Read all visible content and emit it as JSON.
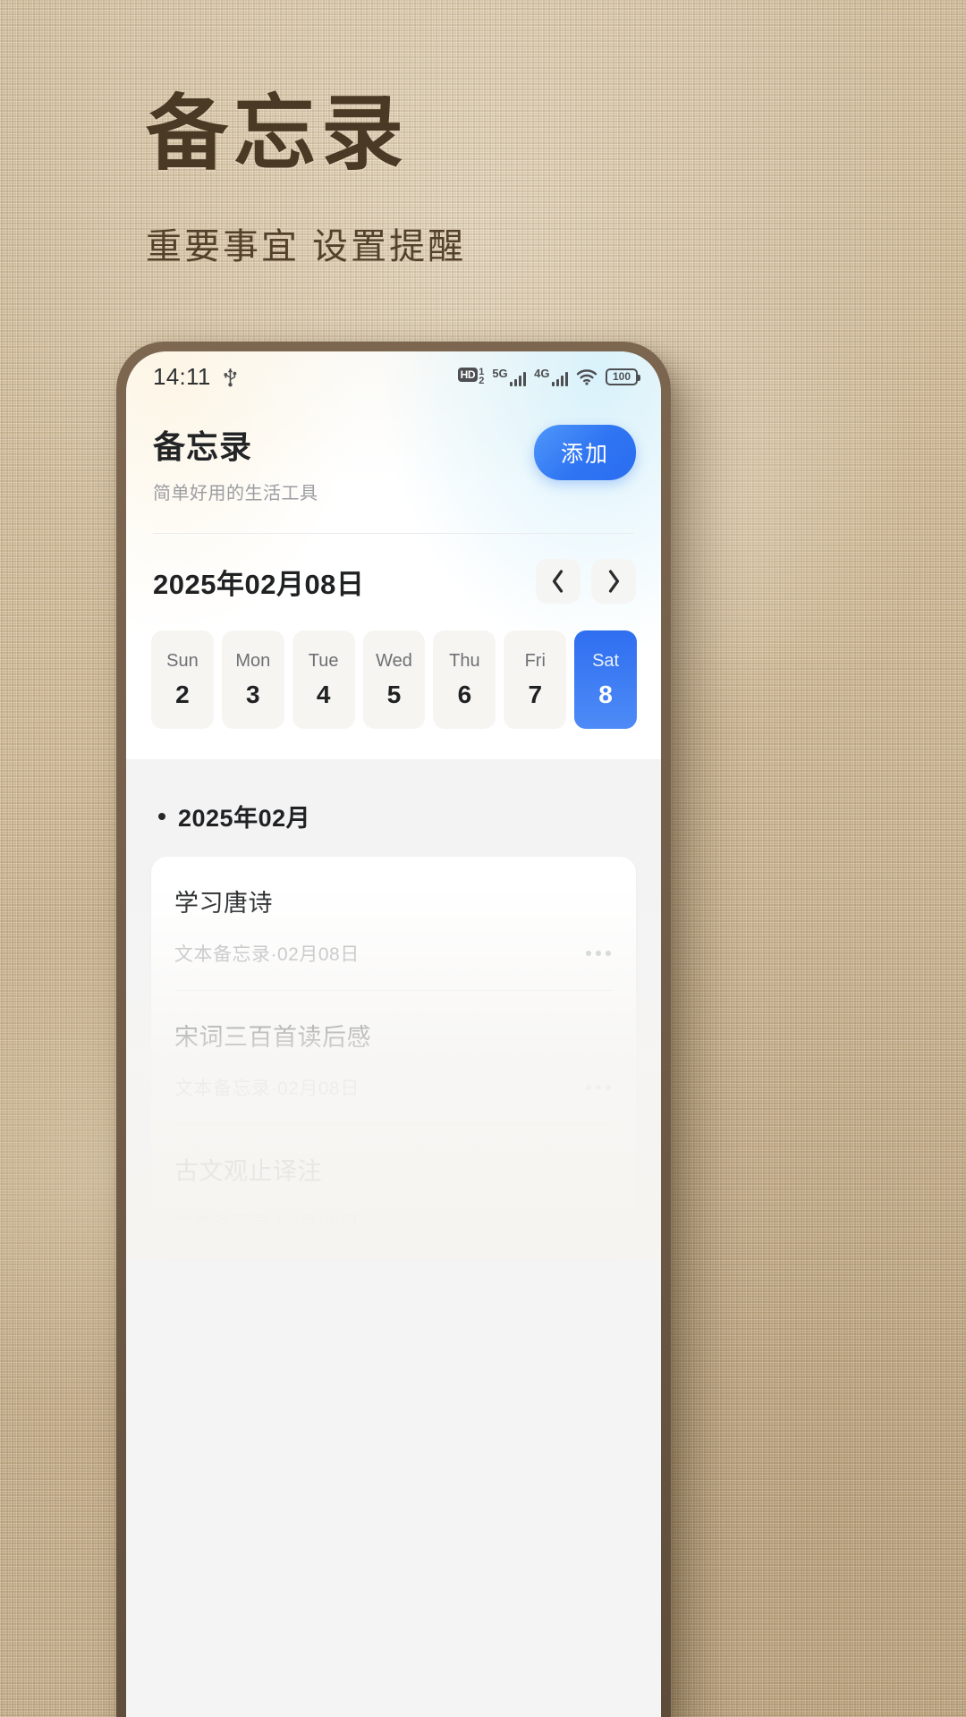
{
  "poster": {
    "title": "备忘录",
    "subtitle": "重要事宜  设置提醒",
    "title_color": "#4a3a25",
    "background_color": "#d3bf9f"
  },
  "statusbar": {
    "time": "14:11",
    "usb_icon": "usb-icon",
    "hd_label": "HD",
    "hd_sim_top": "1",
    "hd_sim_bottom": "2",
    "net_primary": "5G",
    "net_secondary": "4G",
    "wifi_icon": "wifi-icon",
    "battery_level": "100"
  },
  "app": {
    "title": "备忘录",
    "slogan": "简单好用的生活工具",
    "add_label": "添加",
    "accent_color": "#2f74f2"
  },
  "datebar": {
    "current_date": "2025年02月08日",
    "prev_icon": "chevron-left-icon",
    "next_icon": "chevron-right-icon"
  },
  "week": {
    "days": [
      {
        "weekday": "Sun",
        "day": "2",
        "selected": false
      },
      {
        "weekday": "Mon",
        "day": "3",
        "selected": false
      },
      {
        "weekday": "Tue",
        "day": "4",
        "selected": false
      },
      {
        "weekday": "Wed",
        "day": "5",
        "selected": false
      },
      {
        "weekday": "Thu",
        "day": "6",
        "selected": false
      },
      {
        "weekday": "Fri",
        "day": "7",
        "selected": false
      },
      {
        "weekday": "Sat",
        "day": "8",
        "selected": true
      }
    ]
  },
  "notes_section": {
    "heading": "2025年02月",
    "items": [
      {
        "title": "学习唐诗",
        "meta": "文本备忘录·02月08日",
        "more_icon": "more-horizontal-icon"
      },
      {
        "title": "宋词三百首读后感",
        "meta": "文本备忘录·02月08日",
        "more_icon": "more-horizontal-icon"
      },
      {
        "title": "古文观止译注",
        "meta": "文本备忘录·02月08日",
        "more_icon": "more-horizontal-icon"
      }
    ]
  }
}
